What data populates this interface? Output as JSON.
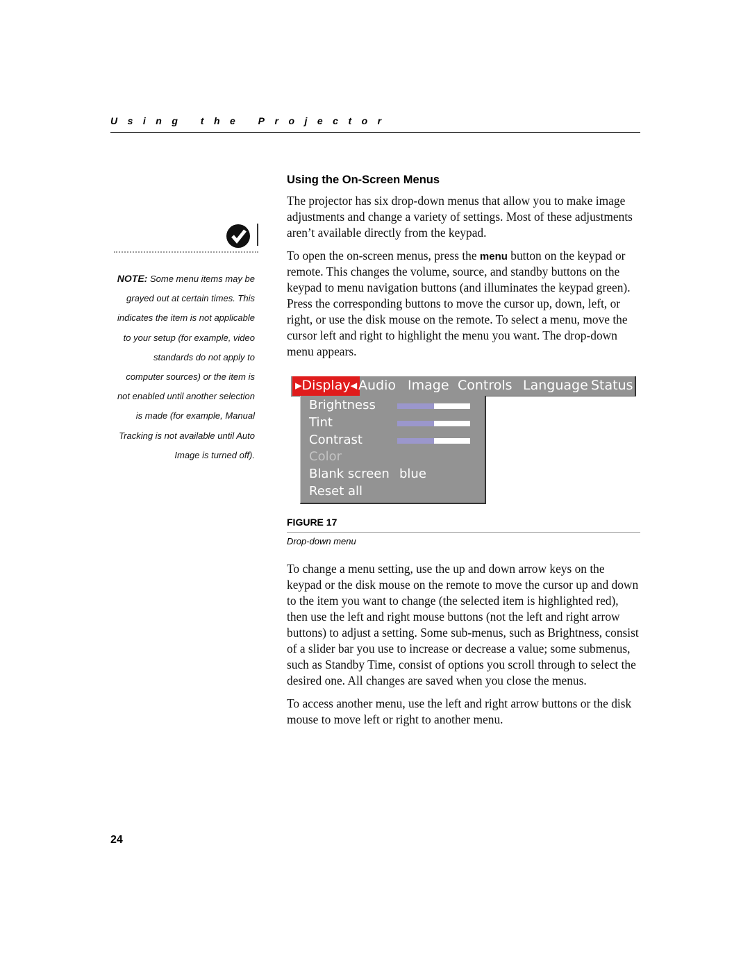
{
  "header": {
    "running_title": "Using the Projector"
  },
  "section": {
    "heading": "Using the On-Screen Menus"
  },
  "paragraphs": {
    "p1": "The projector has six drop-down menus that allow you to make image adjustments and change a variety of settings. Most of these adjustments aren’t available directly from the keypad.",
    "p2_before": "To open the on-screen menus, press the ",
    "p2_keyword": "menu",
    "p2_after": " button on the keypad or remote. This changes the volume, source, and standby buttons on the keypad to menu navigation buttons (and illuminates the keypad green). Press the corresponding buttons to move the cursor up, down, left, or right, or use the disk mouse on the remote. To select a menu, move the cursor left and right to highlight the menu you want. The drop-down menu appears.",
    "p3": "To change a menu setting, use the up and down arrow keys on the keypad or the disk mouse on the remote to move the cursor up and down to the item you want to change (the selected item is highlighted red), then use the left and right mouse buttons (not the left and right arrow buttons) to adjust a setting. Some sub-menus, such as Brightness, consist of a slider bar you use to increase or decrease a value; some submenus, such as Standby Time, consist of options you scroll through to select the desired one. All changes are saved when you close the menus.",
    "p4": "To access another menu, use the left and right arrow buttons or the disk mouse to move left or right to another menu."
  },
  "sidebar": {
    "icon": "check-mark-icon",
    "note_label": "NOTE:",
    "note_lines": [
      "Some menu items may be",
      "grayed out at certain times. This",
      "indicates the item is not applicable",
      "to your setup (for example, video",
      "standards do not apply to",
      "computer sources) or the item is",
      "not enabled until another selection",
      "is made (for example, Manual",
      "Tracking is not available until Auto",
      "Image is turned off)."
    ]
  },
  "figure": {
    "menu_tabs": [
      "Display",
      "Audio",
      "Image",
      "Controls",
      "Language",
      "Status"
    ],
    "active_tab": "Display",
    "items": [
      {
        "label": "Brightness",
        "slider": 0.5
      },
      {
        "label": "Tint",
        "slider": 0.5
      },
      {
        "label": "Contrast",
        "slider": 0.5
      },
      {
        "label": "Color",
        "disabled": true
      },
      {
        "label": "Blank screen",
        "value": "blue"
      },
      {
        "label": "Reset all"
      }
    ],
    "colors": {
      "menu_bg": "#939393",
      "active": "#e01c1c",
      "slider_fill": "#9b97cc"
    },
    "label": "FIGURE 17",
    "caption": "Drop-down menu"
  },
  "page_number": "24"
}
